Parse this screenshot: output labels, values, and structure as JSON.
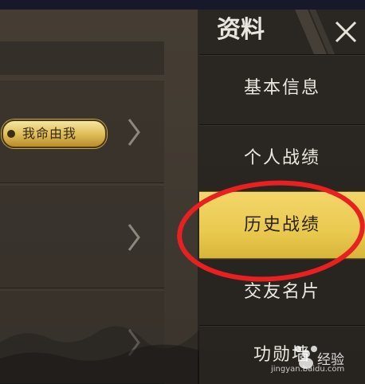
{
  "panel": {
    "title": "资料",
    "close_icon": "close-x-icon"
  },
  "menu": {
    "items": [
      {
        "label": "基本信息",
        "active": false
      },
      {
        "label": "个人战绩",
        "active": false
      },
      {
        "label": "历史战绩",
        "active": true
      },
      {
        "label": "交友名片",
        "active": false
      },
      {
        "label": "功勋墙",
        "active": false
      }
    ]
  },
  "left_list": {
    "rows": [
      {
        "badge": "我命由我",
        "chevron": "chevron-right-icon"
      },
      {
        "chevron": "chevron-right-icon"
      },
      {
        "chevron": "chevron-right-icon"
      }
    ]
  },
  "annotation": {
    "color": "#e8201f"
  },
  "colors": {
    "active_menu": "#f3d66a",
    "menu_bg": "#2b2722",
    "title_text": "#e9e6df"
  },
  "watermark": {
    "text": "经验",
    "sub": "jingyan.baidu.com"
  }
}
